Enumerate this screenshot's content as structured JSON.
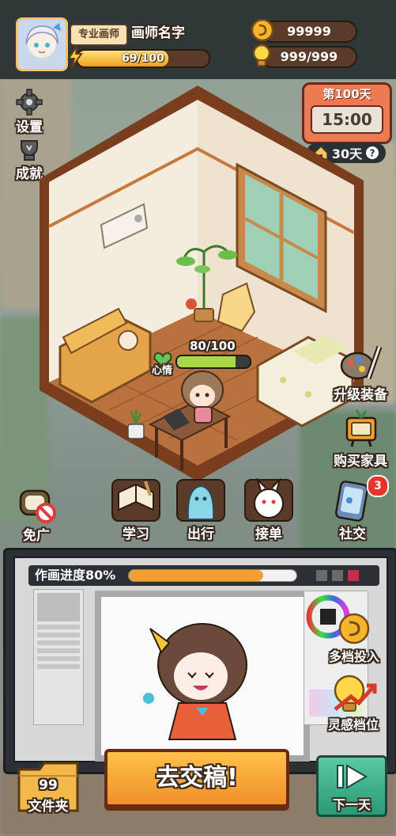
{
  "player": {
    "title_badge": "专业画师",
    "name": "画师名字",
    "energy": "69/100",
    "energy_fraction": 0.69,
    "coins": "99999",
    "inspiration": "999/999"
  },
  "left_menu": {
    "settings": "设置",
    "achievements": "成就"
  },
  "calendar": {
    "day": "第100天",
    "time": "15:00",
    "rent_days": "30天"
  },
  "room": {
    "mood_value": "80/100",
    "mood_fraction": 0.8,
    "mood_label": "心情"
  },
  "actions": {
    "no_ads": "免广",
    "study": "学习",
    "travel": "出行",
    "take_order": "接单",
    "social": "社交",
    "social_badge": "3",
    "upgrade": "升级装备",
    "buy_furniture": "购买家具"
  },
  "workspace": {
    "progress_label": "作画进度80%",
    "progress_fraction": 0.8,
    "multi_invest": "多档投入",
    "inspiration_slot": "灵感档位"
  },
  "bottom": {
    "folder_count": "99",
    "folder_label": "文件夹",
    "submit": "去交稿!",
    "next_day": "下一天"
  },
  "colors": {
    "wood": "#8a4a24",
    "orange": "#f0a030",
    "green": "#5bbf5a",
    "dark_panel": "#2a3034"
  }
}
